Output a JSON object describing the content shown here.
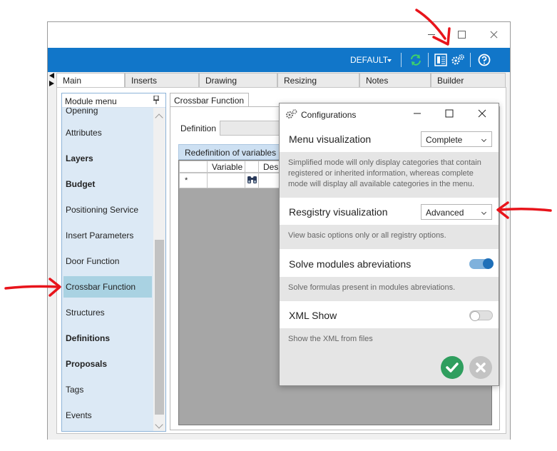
{
  "window": {
    "toolbar": {
      "profile_label": "DEFAULT"
    },
    "tabs": [
      {
        "label": "Main",
        "active": true
      },
      {
        "label": "Inserts",
        "active": false
      },
      {
        "label": "Drawing",
        "active": false
      },
      {
        "label": "Resizing",
        "active": false
      },
      {
        "label": "Notes",
        "active": false
      },
      {
        "label": "Builder",
        "active": false
      }
    ]
  },
  "module_menu": {
    "title": "Module menu",
    "items": [
      {
        "label": "Opening",
        "bold": false
      },
      {
        "label": "Attributes",
        "bold": false
      },
      {
        "label": "Layers",
        "bold": true
      },
      {
        "label": "Budget",
        "bold": true
      },
      {
        "label": "Positioning Service",
        "bold": false
      },
      {
        "label": "Insert Parameters",
        "bold": false
      },
      {
        "label": "Door Function",
        "bold": false
      },
      {
        "label": "Crossbar Function",
        "bold": false,
        "selected": true
      },
      {
        "label": "Structures",
        "bold": false
      },
      {
        "label": "Definitions",
        "bold": true
      },
      {
        "label": "Proposals",
        "bold": true
      },
      {
        "label": "Tags",
        "bold": false
      },
      {
        "label": "Events",
        "bold": false
      }
    ]
  },
  "panel": {
    "tab_label": "Crossbar Function",
    "definition_label": "Definition",
    "redefinition_tab": "Redefinition of variables",
    "grid_headers": [
      "Variable",
      "Des"
    ],
    "new_row_marker": "*"
  },
  "dialog": {
    "title": "Configurations",
    "menu_visualization": {
      "label": "Menu visualization",
      "value": "Complete",
      "description": "Simplified mode will only display categories that contain registered or inherited information, whereas complete mode will display all available categories in the menu."
    },
    "registry_visualization": {
      "label": "Resgistry visualization",
      "value": "Advanced",
      "description": "View basic options only or all registry options."
    },
    "solve_abbreviations": {
      "label": "Solve modules abreviations",
      "enabled": true,
      "description": "Solve formulas present in modules abreviations."
    },
    "xml_show": {
      "label": "XML Show",
      "enabled": false,
      "description": "Show the XML from files"
    }
  },
  "colors": {
    "toolbar_blue": "#1176c9",
    "annotation_red": "#e8141b",
    "ok_green": "#2f9e5e",
    "menu_selection": "#a9d2e2"
  },
  "icons": [
    "refresh-icon",
    "layout-icon",
    "settings-gears-icon",
    "help-icon",
    "pin-icon",
    "binoculars-icon",
    "checkmark-icon",
    "cancel-x-icon"
  ]
}
